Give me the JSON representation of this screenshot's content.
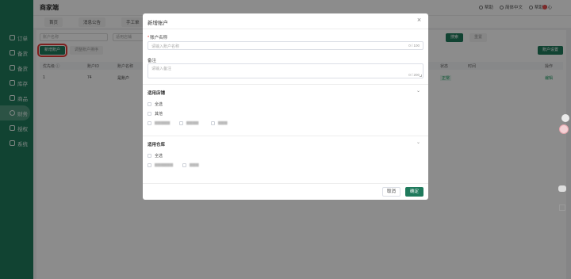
{
  "app": {
    "brand": "商家端",
    "header_right": [
      "帮助",
      "简体中文",
      "帮助中心"
    ]
  },
  "sidebar": {
    "items": [
      {
        "label": "订单",
        "icon": "order-icon"
      },
      {
        "label": "备货",
        "icon": "stock-icon"
      },
      {
        "label": "备货",
        "icon": "stock2-icon"
      },
      {
        "label": "库存",
        "icon": "warehouse-icon"
      },
      {
        "label": "商品",
        "icon": "goods-icon"
      },
      {
        "label": "财务",
        "icon": "finance-icon"
      },
      {
        "label": "授权",
        "icon": "auth-icon"
      },
      {
        "label": "系统",
        "icon": "settings-icon"
      }
    ],
    "active_index": 5
  },
  "tabs": [
    "首页",
    "消息公告",
    "手工单"
  ],
  "filters": {
    "account_placeholder": "账户名称",
    "store_placeholder": "适用店铺",
    "search_label": "搜索",
    "reset_label": "重置"
  },
  "toolbar": {
    "add_label": "新增账户",
    "sort_label": "调整账户排序",
    "account_setting_label": "账户设置"
  },
  "table": {
    "headers": [
      "优先级 ⓘ",
      "账户ID",
      "账户名称",
      "状态",
      "时间",
      "操作"
    ],
    "rows": [
      {
        "priority": "1",
        "id": "74",
        "name": "是账户",
        "status": "正常",
        "action": "编辑"
      }
    ]
  },
  "modal": {
    "title": "新增账户",
    "account_name_label": "账户名称",
    "account_name_placeholder": "请输入账户名称",
    "account_name_count": "0 / 100",
    "remark_label": "备注",
    "remark_placeholder": "请输入备注",
    "remark_count": "0 / 200",
    "store_section_title": "适用店铺",
    "store_options": [
      "全选",
      "其他"
    ],
    "warehouse_section_title": "适用仓库",
    "warehouse_options": [
      "全选"
    ],
    "cancel_label": "取消",
    "ok_label": "确定"
  },
  "colors": {
    "brand_green": "#1f7a5c",
    "highlight_red": "#e53935"
  }
}
